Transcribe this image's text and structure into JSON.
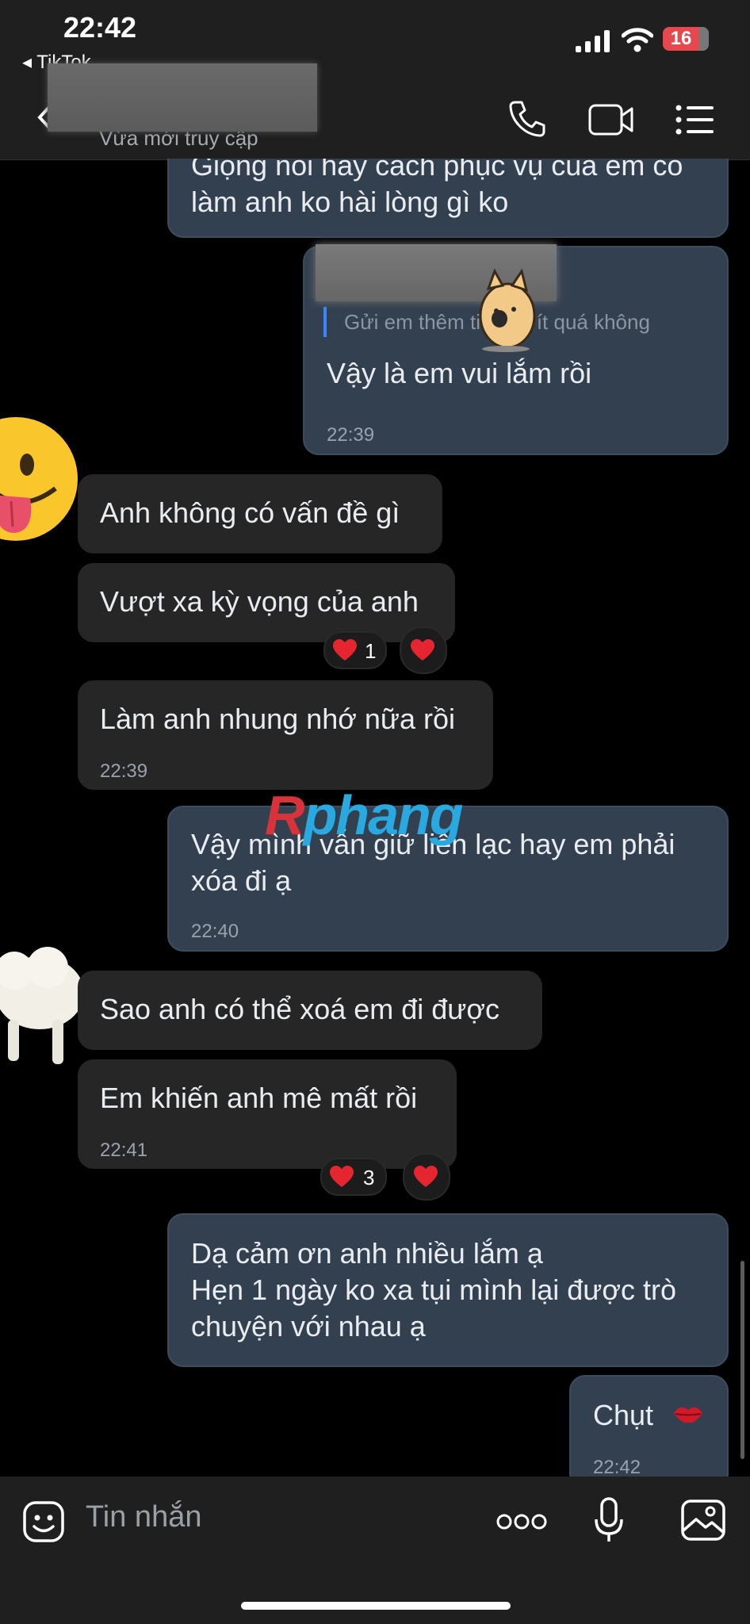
{
  "status_bar": {
    "time": "22:42",
    "back_app": "◂ TikTok",
    "battery": "16"
  },
  "header": {
    "subtitle": "Vừa mới truy cập"
  },
  "messages": [
    {
      "text": "Giọng nói hay cách phục vụ của em có\nlàm anh ko hài lòng gì ko"
    },
    {
      "quote": "Gửi em thêm tiền có ít quá không",
      "text": "Vậy là em vui lắm rồi",
      "time": "22:39"
    },
    {
      "text": "Anh không có vấn đề gì"
    },
    {
      "text": "Vượt xa kỳ vọng của anh",
      "reaction_count": "1"
    },
    {
      "text": "Làm anh nhung nhớ nữa rồi",
      "time": "22:39"
    },
    {
      "text": "Vậy mình vẫn giữ liên lạc hay em phải\nxóa đi ạ",
      "time": "22:40"
    },
    {
      "text": "Sao anh có thể xoá em đi được"
    },
    {
      "text": "Em khiến anh mê mất rồi",
      "time": "22:41",
      "reaction_count": "3"
    },
    {
      "text": "Dạ cảm ơn anh nhiều lắm ạ\nHẹn 1 ngày ko xa tụi mình lại được trò\nchuyện với nhau ạ"
    },
    {
      "text": "Chụt",
      "time": "22:42"
    }
  ],
  "watermark": {
    "part1": "R",
    "part2": "phang"
  },
  "input": {
    "placeholder": "Tin nhắn"
  },
  "colors": {
    "accent": "#3a86ff",
    "heart": "#e5252f",
    "outgoing_bubble": "#334050",
    "incoming_bubble": "#262626"
  }
}
